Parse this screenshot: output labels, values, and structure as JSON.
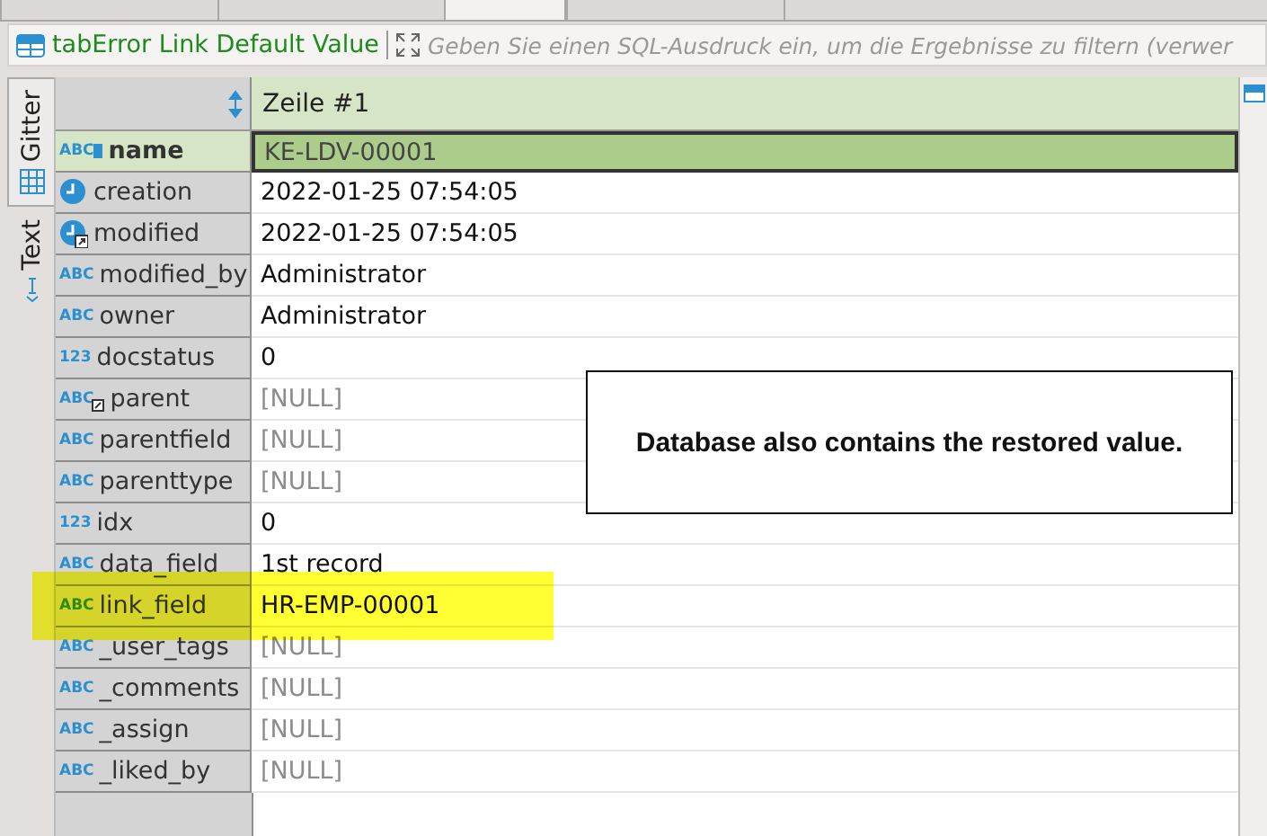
{
  "table_title": "tabError Link Default Value",
  "filter": {
    "placeholder": "Geben Sie einen SQL-Ausdruck ein, um die Ergebnisse zu filtern (verwer"
  },
  "side_tabs": [
    {
      "label": "Gitter",
      "kind": "grid",
      "selected": true
    },
    {
      "label": "Text",
      "kind": "text",
      "selected": false
    }
  ],
  "column_header": "Zeile #1",
  "rows": [
    {
      "field": "name",
      "kind": "text-key",
      "type_label": "ABC",
      "value": "KE-LDV-00001",
      "null": false,
      "selected": true,
      "highlighted": false
    },
    {
      "field": "creation",
      "kind": "datetime",
      "value": "2022-01-25 07:54:05",
      "null": false,
      "selected": false,
      "highlighted": false
    },
    {
      "field": "modified",
      "kind": "datetime-link",
      "value": "2022-01-25 07:54:05",
      "null": false,
      "selected": false,
      "highlighted": false
    },
    {
      "field": "modified_by",
      "kind": "text",
      "type_label": "ABC",
      "value": "Administrator",
      "null": false,
      "selected": false,
      "highlighted": false
    },
    {
      "field": "owner",
      "kind": "text",
      "type_label": "ABC",
      "value": "Administrator",
      "null": false,
      "selected": false,
      "highlighted": false
    },
    {
      "field": "docstatus",
      "kind": "number",
      "type_label": "123",
      "value": "0",
      "null": false,
      "selected": false,
      "highlighted": false
    },
    {
      "field": "parent",
      "kind": "text-link",
      "type_label": "ABC",
      "value": "[NULL]",
      "null": true,
      "selected": false,
      "highlighted": false
    },
    {
      "field": "parentfield",
      "kind": "text",
      "type_label": "ABC",
      "value": "[NULL]",
      "null": true,
      "selected": false,
      "highlighted": false
    },
    {
      "field": "parenttype",
      "kind": "text",
      "type_label": "ABC",
      "value": "[NULL]",
      "null": true,
      "selected": false,
      "highlighted": false
    },
    {
      "field": "idx",
      "kind": "number",
      "type_label": "123",
      "value": "0",
      "null": false,
      "selected": false,
      "highlighted": false
    },
    {
      "field": "data_field",
      "kind": "text",
      "type_label": "ABC",
      "value": "1st record",
      "null": false,
      "selected": false,
      "highlighted": false
    },
    {
      "field": "link_field",
      "kind": "text",
      "type_label": "ABC",
      "value": "HR-EMP-00001",
      "null": false,
      "selected": false,
      "highlighted": true
    },
    {
      "field": "_user_tags",
      "kind": "text",
      "type_label": "ABC",
      "value": "[NULL]",
      "null": true,
      "selected": false,
      "highlighted": false
    },
    {
      "field": "_comments",
      "kind": "text",
      "type_label": "ABC",
      "value": "[NULL]",
      "null": true,
      "selected": false,
      "highlighted": false
    },
    {
      "field": "_assign",
      "kind": "text",
      "type_label": "ABC",
      "value": "[NULL]",
      "null": true,
      "selected": false,
      "highlighted": false
    },
    {
      "field": "_liked_by",
      "kind": "text",
      "type_label": "ABC",
      "value": "[NULL]",
      "null": true,
      "selected": false,
      "highlighted": false
    }
  ],
  "note": "Database also contains the restored value."
}
